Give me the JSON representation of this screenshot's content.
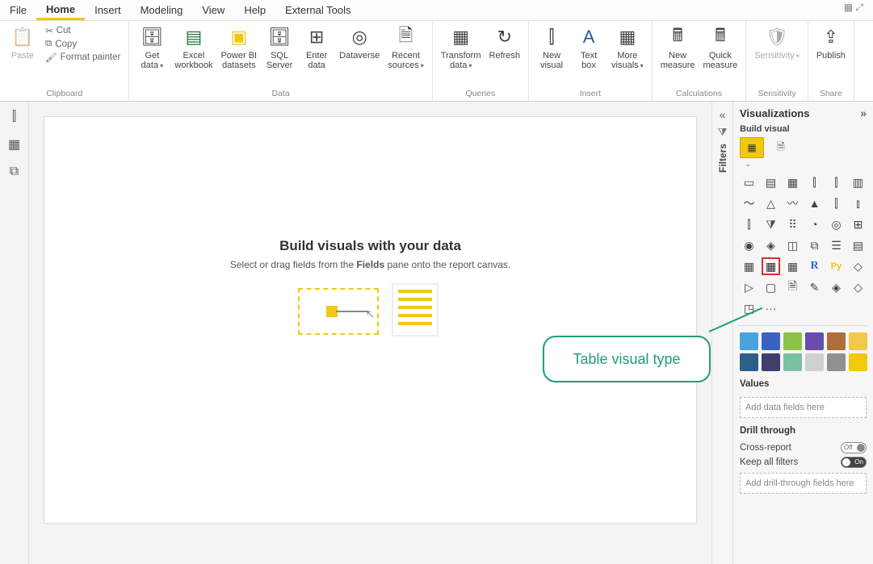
{
  "menu": {
    "file": "File",
    "home": "Home",
    "insert": "Insert",
    "modeling": "Modeling",
    "view": "View",
    "help": "Help",
    "external": "External Tools"
  },
  "ribbon": {
    "groups": {
      "clipboard": {
        "label": "Clipboard",
        "paste": "Paste",
        "cut": "Cut",
        "copy": "Copy",
        "fmt": "Format painter"
      },
      "data": {
        "label": "Data",
        "get": "Get\ndata",
        "excel": "Excel\nworkbook",
        "pbi": "Power BI\ndatasets",
        "sql": "SQL\nServer",
        "enter": "Enter\ndata",
        "dvs": "Dataverse",
        "recent": "Recent\nsources"
      },
      "queries": {
        "label": "Queries",
        "transform": "Transform\ndata",
        "refresh": "Refresh"
      },
      "insert": {
        "label": "Insert",
        "newv": "New\nvisual",
        "textbox": "Text\nbox",
        "morev": "More\nvisuals"
      },
      "calc": {
        "label": "Calculations",
        "newm": "New\nmeasure",
        "quick": "Quick\nmeasure"
      },
      "sens": {
        "label": "Sensitivity",
        "btn": "Sensitivity"
      },
      "share": {
        "label": "Share",
        "publish": "Publish"
      }
    }
  },
  "canvas": {
    "title": "Build visuals with your data",
    "sub_pre": "Select or drag fields from the ",
    "sub_bold": "Fields",
    "sub_post": " pane onto the report canvas."
  },
  "filters": {
    "label": "Filters"
  },
  "viz": {
    "title": "Visualizations",
    "build": "Build visual",
    "moredots": "···",
    "values": "Values",
    "values_ph": "Add data fields here",
    "drill": "Drill through",
    "cross": "Cross-report",
    "cross_state": "Off",
    "keep": "Keep all filters",
    "keep_state": "On",
    "drill_ph": "Add drill-through fields here"
  },
  "vizIcons": [
    "▭",
    "▤",
    "▦",
    "⫿",
    "⫿",
    "▥",
    "〜",
    "△",
    "〰",
    "▲",
    "⫿",
    "⫾",
    "⫿",
    "⧩",
    "⠿",
    "◔",
    "◎",
    "⊞",
    "◉",
    "◈",
    "◫",
    "⧉",
    "☰",
    "▤",
    "▦",
    "▦",
    "▦",
    "R",
    "Py",
    "◇",
    "▷",
    "▢",
    "🗎",
    "✎",
    "◈",
    "◇",
    "◳"
  ],
  "miscColors": [
    "#4aa3df",
    "#3a62c4",
    "#8bc34a",
    "#6a4caf",
    "#b06c3b",
    "#f2c94c",
    "#2d5f8b",
    "#3e3e6e",
    "#7ac1a0",
    "#d0d0d0",
    "#909090",
    "#f2c811"
  ],
  "callout": "Table visual type"
}
